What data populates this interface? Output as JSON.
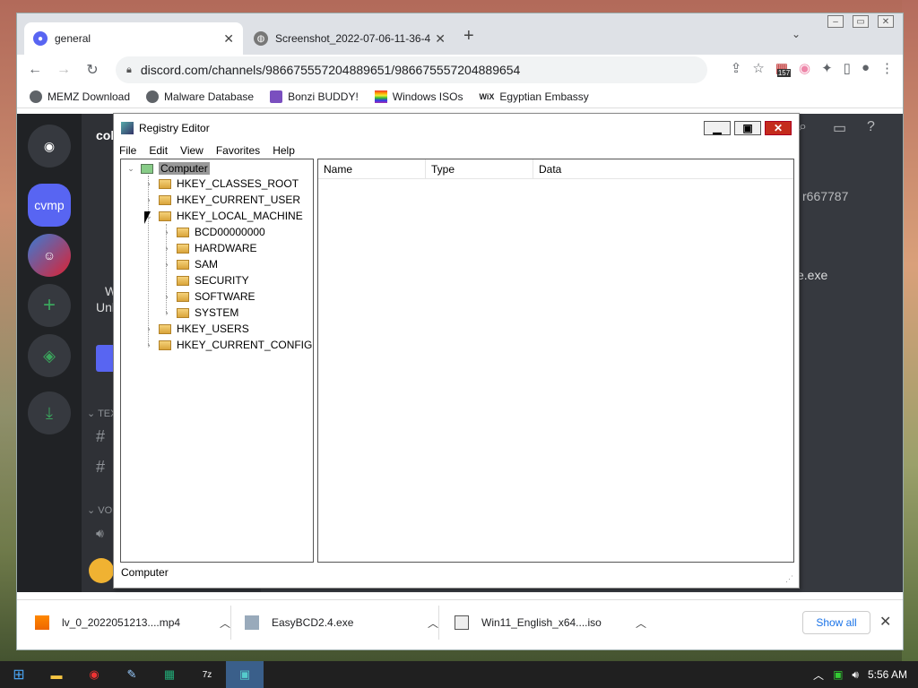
{
  "browser": {
    "tabs": [
      {
        "label": "general",
        "active": true
      },
      {
        "label": "Screenshot_2022-07-06-11-36-4",
        "active": false
      }
    ],
    "url": "discord.com/channels/986675557204889651/986675557204889654",
    "extension_badge": "157",
    "bookmarks": [
      "MEMZ Download",
      "Malware Database",
      "Bonzi BUDDY!",
      "Windows ISOs",
      "Egyptian Embassy"
    ]
  },
  "discord": {
    "server_label": "cvmp",
    "partial_title": "col",
    "partial_user": "r667787",
    "partial_file": "e.exe",
    "partial_line1": "W",
    "partial_line2": "Unl",
    "section_text": "TEX",
    "section_voice": "VO"
  },
  "regedit": {
    "title": "Registry Editor",
    "menu": [
      "File",
      "Edit",
      "View",
      "Favorites",
      "Help"
    ],
    "root": "Computer",
    "hives": [
      "HKEY_CLASSES_ROOT",
      "HKEY_CURRENT_USER",
      "HKEY_LOCAL_MACHINE",
      "HKEY_USERS",
      "HKEY_CURRENT_CONFIG"
    ],
    "hklm_children": [
      "BCD00000000",
      "HARDWARE",
      "SAM",
      "SECURITY",
      "SOFTWARE",
      "SYSTEM"
    ],
    "columns": [
      "Name",
      "Type",
      "Data"
    ],
    "status": "Computer"
  },
  "downloads": {
    "items": [
      "lv_0_2022051213....mp4",
      "EasyBCD2.4.exe",
      "Win11_English_x64....iso"
    ],
    "show_all": "Show all"
  },
  "taskbar": {
    "time": "5:56 AM"
  },
  "colors": {
    "discord_bg": "#36393f",
    "discord_rail": "#202225",
    "discord_green": "#3ba55d",
    "chrome_tabbar": "#dee1e6"
  }
}
